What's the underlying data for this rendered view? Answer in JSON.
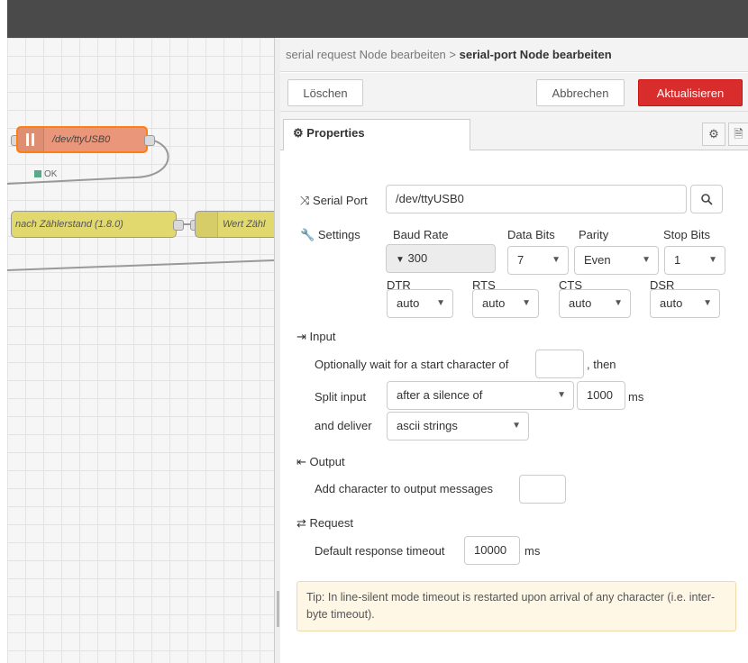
{
  "canvas": {
    "serial_node_label": "/dev/ttyUSB0",
    "serial_node_status": "OK",
    "function_node_label": "nach Zählerstand (1.8.0)",
    "wert_node_label": "Wert Zähl"
  },
  "tray": {
    "breadcrumb_parent": "serial request Node bearbeiten",
    "breadcrumb_sep": ">",
    "breadcrumb_current": "serial-port Node bearbeiten",
    "delete_label": "Löschen",
    "cancel_label": "Abbrechen",
    "update_label": "Aktualisieren",
    "tab_properties": "Properties"
  },
  "form": {
    "serial_port_label": "Serial Port",
    "serial_port_value": "/dev/ttyUSB0",
    "settings_label": "Settings",
    "baud_rate_label": "Baud Rate",
    "baud_rate_value": "300",
    "data_bits_label": "Data Bits",
    "data_bits_value": "7",
    "parity_label": "Parity",
    "parity_value": "Even",
    "stop_bits_label": "Stop Bits",
    "stop_bits_value": "1",
    "dtr_label": "DTR",
    "dtr_value": "auto",
    "rts_label": "RTS",
    "rts_value": "auto",
    "cts_label": "CTS",
    "cts_value": "auto",
    "dsr_label": "DSR",
    "dsr_value": "auto",
    "input_section": "Input",
    "start_char_text": "Optionally wait for a start character of",
    "start_char_value": "",
    "then_text": ", then",
    "split_input_label": "Split input",
    "split_input_value": "after a silence of",
    "split_value": "1000",
    "ms_unit": "ms",
    "deliver_label": "and deliver",
    "deliver_value": "ascii strings",
    "output_section": "Output",
    "add_char_text": "Add character to output messages",
    "add_char_value": "",
    "request_section": "Request",
    "timeout_label": "Default response timeout",
    "timeout_value": "10000",
    "timeout_unit": "ms",
    "tip_text": "Tip: In line-silent mode timeout is restarted upon arrival of any character (i.e. inter-byte timeout)."
  },
  "colors": {
    "update_button": "#d92c2c",
    "topbar": "#4a4a4a",
    "serial_node": "#e9967a",
    "function_node": "#e2d96e",
    "tip_bg": "#fff7e6"
  },
  "icons": {
    "serial_port": "shuffle-icon",
    "settings": "wrench-icon",
    "input": "sign-in-icon",
    "output": "sign-out-icon",
    "request": "exchange-icon",
    "search": "search-icon",
    "gear": "gear-icon",
    "doc": "document-icon"
  }
}
